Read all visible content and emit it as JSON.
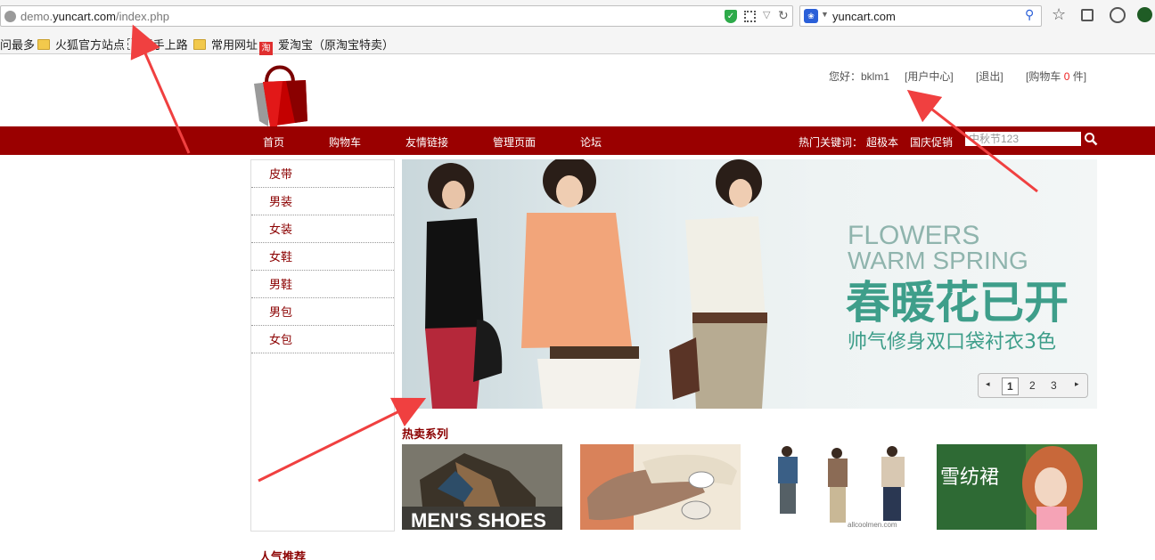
{
  "browser": {
    "url_prefix": "demo.",
    "url_domain": "yuncart.com",
    "url_path": "/index.php",
    "search_text": "yuncart.com",
    "bookmarks": [
      "问最多",
      "火狐官方站点",
      "新手上路",
      "常用网址",
      "爱淘宝（原淘宝特卖）"
    ],
    "taobao_glyph": "淘"
  },
  "userbar": {
    "greeting": "您好：bklm1",
    "user_center": "[用户中心]",
    "logout": "[退出]",
    "cart_prefix": "[购物车",
    "cart_count": "0",
    "cart_suffix": "件]"
  },
  "nav": {
    "items": [
      "首页",
      "购物车",
      "友情链接",
      "管理页面",
      "论坛"
    ],
    "hot_label": "热门关键词：",
    "keywords": [
      "超极本",
      "国庆促销"
    ],
    "search_placeholder": "中秋节123"
  },
  "sidebar": {
    "categories": [
      "皮带",
      "男装",
      "女装",
      "女鞋",
      "男鞋",
      "男包",
      "女包"
    ]
  },
  "banner": {
    "line1": "FLOWERS",
    "line2": "WARM SPRING",
    "line3": "春暖花已开",
    "line4": "帅气修身双口袋衬衣3色",
    "pages": [
      "1",
      "2",
      "3"
    ],
    "active_page": "1"
  },
  "hot_series": {
    "title": "热卖系列",
    "thumb1_text": "MEN'S SHOES",
    "thumb3_caption": "allcoolmen.com",
    "thumb4_text": "雪纺裙"
  },
  "popular": {
    "title": "人气推荐"
  },
  "colors": {
    "nav_red": "#9a0000",
    "category_red": "#8b0000",
    "banner_green": "#3e9e8a",
    "arrow_red": "#f04040"
  }
}
